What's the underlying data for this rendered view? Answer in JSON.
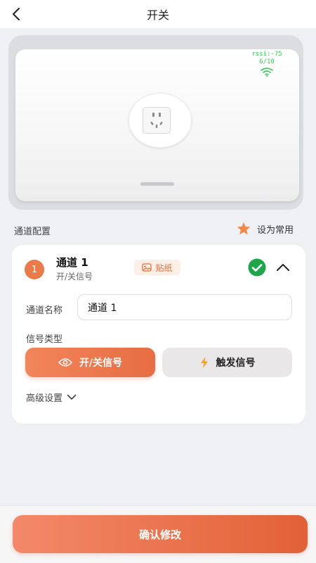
{
  "header": {
    "title": "开关",
    "back_icon": "chevron-left-icon"
  },
  "device": {
    "signal": {
      "rssi": "rssi:-75",
      "level": "6/10",
      "color": "#2fce4f",
      "icon": "wifi-icon"
    },
    "socket_icon": "power-socket-icon"
  },
  "section": {
    "title": "通道配置",
    "favorite": {
      "label": "设为常用",
      "icon": "star-icon",
      "color": "#f08a4b"
    }
  },
  "channel": {
    "number": "1",
    "title": "通道 1",
    "subtitle": "开/关信号",
    "sticker_label": "贴纸",
    "status": "enabled",
    "name_label": "通道名称",
    "name_value": "通道 1",
    "type_label": "信号类型",
    "types": [
      {
        "label": "开/关信号",
        "icon": "eye-icon",
        "selected": true
      },
      {
        "label": "触发信号",
        "icon": "lightning-icon",
        "selected": false
      }
    ],
    "advanced_label": "高级设置"
  },
  "footer": {
    "confirm_label": "确认修改"
  },
  "colors": {
    "accent": "#e76d43",
    "check": "#1fa64b"
  }
}
